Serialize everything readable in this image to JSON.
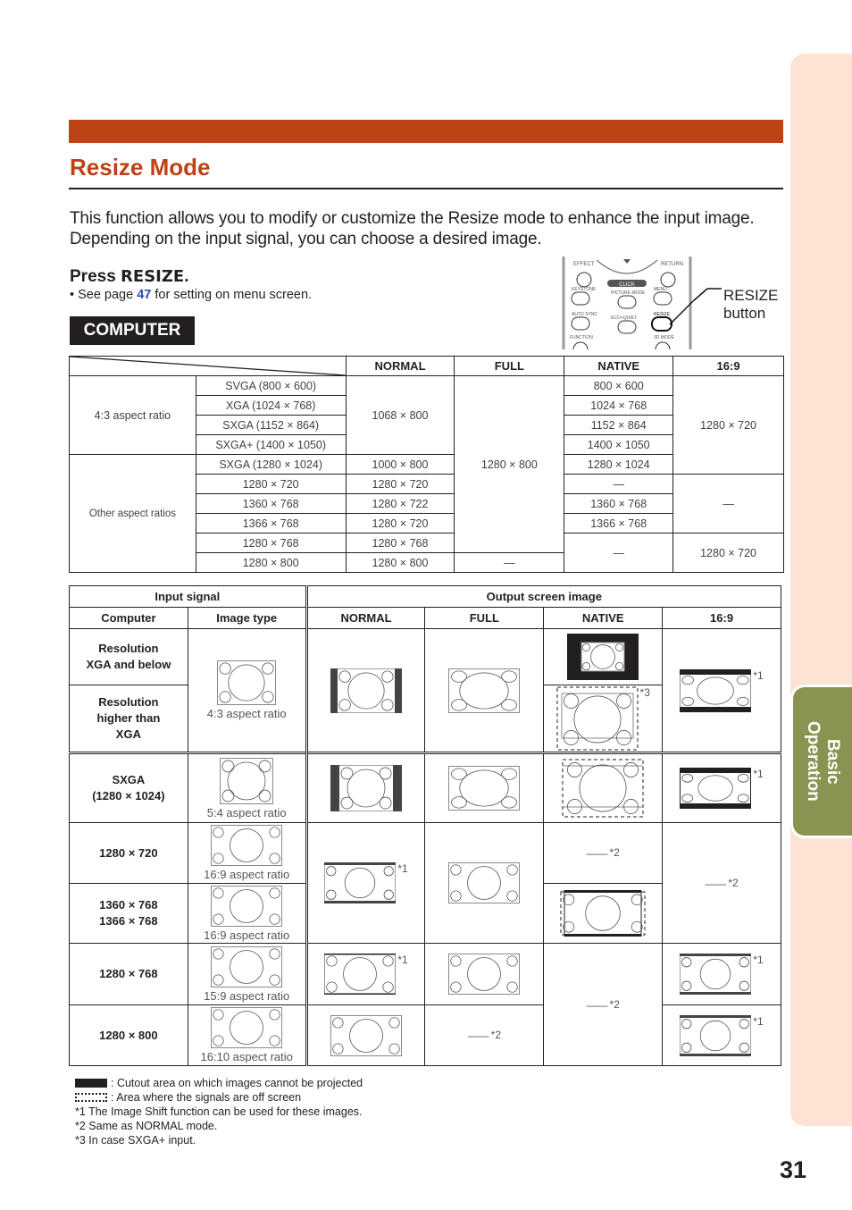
{
  "side_tab": {
    "line1": "Basic",
    "line2": "Operation",
    "color": "#8a9350"
  },
  "header": {
    "title": "Resize Mode",
    "accent": "#bd4216"
  },
  "intro": "This function allows you to modify or customize the Resize mode to enhance the input image. Depending on the input signal, you can choose a desired image.",
  "press": {
    "prefix": "Press ",
    "key": "RESIZE",
    "suffix": "."
  },
  "see_page": {
    "prefix": "• See page ",
    "page": "47",
    "suffix": " for setting on menu screen."
  },
  "badge": "COMPUTER",
  "remote": {
    "labels": [
      "EFFECT",
      "RETURN",
      "CLICK",
      "KEYSTONE",
      "PICTURE MODE",
      "MENU",
      "AUTO SYNC",
      "ECO+QUIET",
      "RESIZE",
      "FUNCTION",
      "3D MODE"
    ],
    "callout_line1": "RESIZE",
    "callout_line2": "button"
  },
  "resolution_table": {
    "headers": [
      "NORMAL",
      "FULL",
      "NATIVE",
      "16:9"
    ],
    "group1": {
      "label": "4:3 aspect ratio",
      "normal": "1068 × 800",
      "sixteen_nine": "1280 × 720"
    },
    "group2": {
      "label": "Other aspect ratios"
    },
    "full_merged": "1280 × 800",
    "rows": [
      {
        "input": "SVGA (800 × 600)",
        "native": "800 × 600"
      },
      {
        "input": "XGA (1024 × 768)",
        "native": "1024 × 768"
      },
      {
        "input": "SXGA (1152 × 864)",
        "native": "1152 × 864"
      },
      {
        "input": "SXGA+ (1400 × 1050)",
        "native": "1400 × 1050"
      },
      {
        "input": "SXGA (1280 × 1024)",
        "normal": "1000 × 800",
        "native": "1280 × 1024"
      },
      {
        "input": "1280 × 720",
        "normal": "1280 × 720",
        "native": "—"
      },
      {
        "input": "1360 × 768",
        "normal": "1280 × 722",
        "native": "1360 × 768"
      },
      {
        "input": "1366 × 768",
        "normal": "1280 × 720",
        "native": "1366 × 768"
      },
      {
        "input": "1280 × 768",
        "normal": "1280 × 768"
      },
      {
        "input": "1280 × 800",
        "normal": "1280 × 800",
        "full": "—"
      }
    ],
    "sixteen_nine_mid": "—",
    "native_tail": "—",
    "sixteen_nine_tail": "1280 × 720"
  },
  "output_table": {
    "group_input": "Input signal",
    "group_output": "Output screen image",
    "col_computer": "Computer",
    "col_image_type": "Image type",
    "cols": [
      "NORMAL",
      "FULL",
      "NATIVE",
      "16:9"
    ],
    "rows": [
      {
        "label1": "Resolution",
        "label2": "XGA and below"
      },
      {
        "label1": "Resolution",
        "label2": "higher than",
        "label3": "XGA"
      },
      {
        "label1": "SXGA",
        "label2": "(1280 × 1024)"
      },
      {
        "label1": "1280 × 720"
      },
      {
        "label1": "1360 × 768",
        "label2": "1366 × 768"
      },
      {
        "label1": "1280 × 768"
      },
      {
        "label1": "1280 × 800"
      }
    ],
    "captions": [
      "4:3 aspect ratio",
      "5:4 aspect ratio",
      "16:9 aspect ratio",
      "16:9 aspect ratio",
      "15:9 aspect ratio",
      "16:10 aspect ratio"
    ],
    "note1": "*1",
    "note2": "*2",
    "note3": "*3",
    "dash": "——"
  },
  "legend": {
    "cutout": ": Cutout area on which images cannot be projected",
    "offscreen": ": Area where the signals are off screen",
    "n1": "*1 The Image Shift function can be used for these images.",
    "n2": "*2 Same as NORMAL mode.",
    "n3": "*3 In case SXGA+ input."
  },
  "page_number": "31"
}
